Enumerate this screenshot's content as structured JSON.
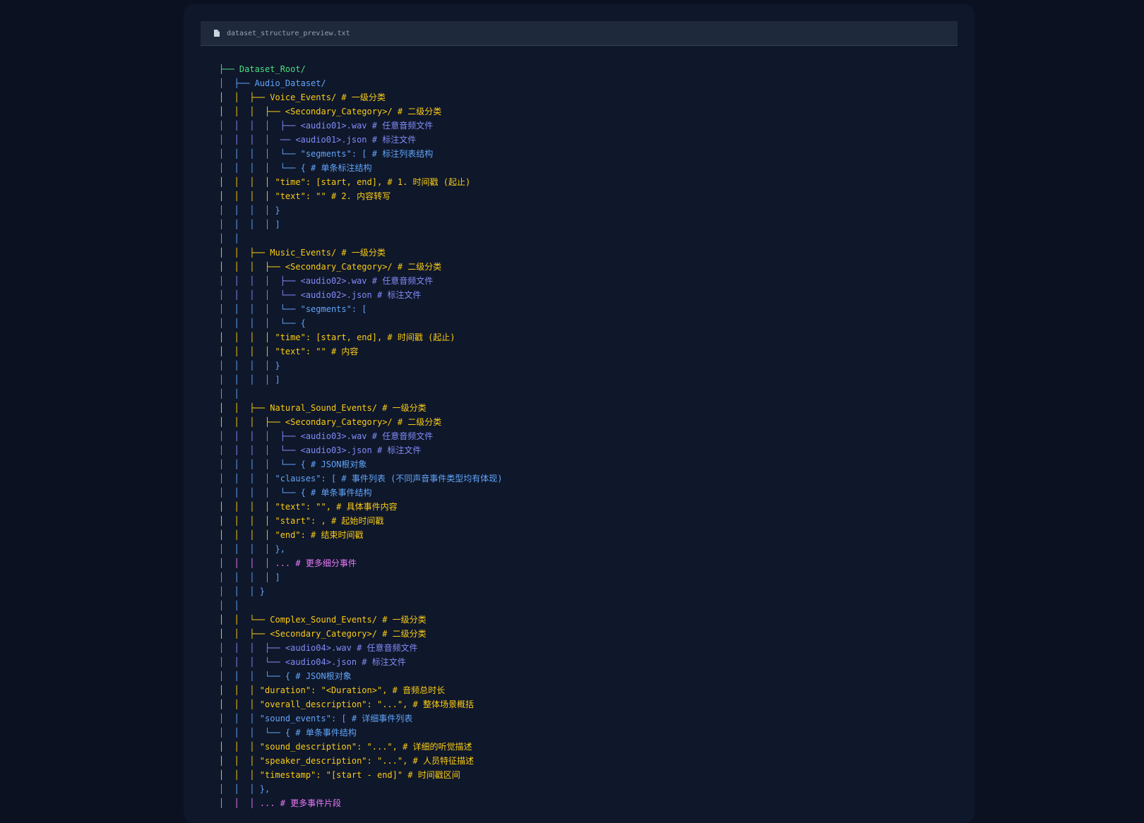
{
  "file": {
    "name": "dataset_structure_preview.txt",
    "icon": "file-icon"
  },
  "colors": {
    "background": "#0b1120",
    "panel": "#0f172a",
    "tab": "#1e293b",
    "green": "#4ade80",
    "blue": "#60a5fa",
    "yellow": "#facc15",
    "indigo": "#818cf8",
    "pink": "#e879f9"
  },
  "lines": [
    {
      "text": "├── Dataset_Root/",
      "color": "green"
    },
    {
      "text": "│  ├── Audio_Dataset/",
      "color": "blue"
    },
    {
      "text": "│  │  ├── Voice_Events/ # 一级分类",
      "color": "yellow"
    },
    {
      "text": "│  │  │  ├── <Secondary_Category>/ # 二级分类",
      "color": "yellow"
    },
    {
      "text": "│  │  │  │  ├── <audio01>.wav # 任意音频文件",
      "color": "indigo"
    },
    {
      "text": "│  │  │  │  ── <audio01>.json # 标注文件",
      "color": "indigo"
    },
    {
      "text": "│  │  │  │  └── \"segments\": [ # 标注列表结构",
      "color": "blue"
    },
    {
      "text": "│  │  │  │  └── { # 单条标注结构",
      "color": "blue"
    },
    {
      "text": "│  │  │  │ \"time\": [start, end], # 1. 时间戳 (起止)",
      "color": "yellow"
    },
    {
      "text": "│  │  │  │ \"text\": \"\" # 2. 内容转写",
      "color": "yellow"
    },
    {
      "text": "│  │  │  │ }",
      "color": "blue"
    },
    {
      "text": "│  │  │  │ ]",
      "color": "blue"
    },
    {
      "text": "│  │",
      "color": "blue"
    },
    {
      "text": "│  │  ├── Music_Events/ # 一级分类",
      "color": "yellow"
    },
    {
      "text": "│  │  │  ├── <Secondary_Category>/ # 二级分类",
      "color": "yellow"
    },
    {
      "text": "│  │  │  │  ├── <audio02>.wav # 任意音频文件",
      "color": "indigo"
    },
    {
      "text": "│  │  │  │  └── <audio02>.json # 标注文件",
      "color": "indigo"
    },
    {
      "text": "│  │  │  │  └── \"segments\": [",
      "color": "blue"
    },
    {
      "text": "│  │  │  │  └── {",
      "color": "blue"
    },
    {
      "text": "│  │  │  │ \"time\": [start, end], # 时间戳 (起止)",
      "color": "yellow"
    },
    {
      "text": "│  │  │  │ \"text\": \"\" # 内容",
      "color": "yellow"
    },
    {
      "text": "│  │  │  │ }",
      "color": "blue"
    },
    {
      "text": "│  │  │  │ ]",
      "color": "blue"
    },
    {
      "text": "│  │",
      "color": "blue"
    },
    {
      "text": "│  │  ├── Natural_Sound_Events/ # 一级分类",
      "color": "yellow"
    },
    {
      "text": "│  │  │  ├── <Secondary_Category>/ # 二级分类",
      "color": "yellow"
    },
    {
      "text": "│  │  │  │  ├── <audio03>.wav # 任意音频文件",
      "color": "indigo"
    },
    {
      "text": "│  │  │  │  └── <audio03>.json # 标注文件",
      "color": "indigo"
    },
    {
      "text": "│  │  │  │  └── { # JSON根对象",
      "color": "blue"
    },
    {
      "text": "│  │  │  │ \"clauses\": [ # 事件列表 (不同声音事件类型均有体现)",
      "color": "blue"
    },
    {
      "text": "│  │  │  │  └── { # 单条事件结构",
      "color": "blue"
    },
    {
      "text": "│  │  │  │ \"text\": \"\", # 具体事件内容",
      "color": "yellow"
    },
    {
      "text": "│  │  │  │ \"start\": , # 起始时间戳",
      "color": "yellow"
    },
    {
      "text": "│  │  │  │ \"end\": # 结束时间戳",
      "color": "yellow"
    },
    {
      "text": "│  │  │  │ },",
      "color": "blue"
    },
    {
      "text": "│  │  │  │ ... # 更多细分事件",
      "color": "pink"
    },
    {
      "text": "│  │  │  │ ]",
      "color": "blue"
    },
    {
      "text": "│  │  │ }",
      "color": "blue"
    },
    {
      "text": "│  │",
      "color": "blue"
    },
    {
      "text": "│  │  └── Complex_Sound_Events/ # 一级分类",
      "color": "yellow"
    },
    {
      "text": "│  │  ├── <Secondary_Category>/ # 二级分类",
      "color": "yellow"
    },
    {
      "text": "│  │  │  ├── <audio04>.wav # 任意音频文件",
      "color": "indigo"
    },
    {
      "text": "│  │  │  └── <audio04>.json # 标注文件",
      "color": "indigo"
    },
    {
      "text": "│  │  │  └── { # JSON根对象",
      "color": "blue"
    },
    {
      "text": "│  │  │ \"duration\": \"<Duration>\", # 音频总时长",
      "color": "yellow"
    },
    {
      "text": "│  │  │ \"overall_description\": \"...\", # 整体场景概括",
      "color": "yellow"
    },
    {
      "text": "│  │  │ \"sound_events\": [ # 详细事件列表",
      "color": "blue"
    },
    {
      "text": "│  │  │  └── { # 单条事件结构",
      "color": "blue"
    },
    {
      "text": "│  │  │ \"sound_description\": \"...\", # 详细的听觉描述",
      "color": "yellow"
    },
    {
      "text": "│  │  │ \"speaker_description\": \"...\", # 人员特征描述",
      "color": "yellow"
    },
    {
      "text": "│  │  │ \"timestamp\": \"[start - end]\" # 时间戳区间",
      "color": "yellow"
    },
    {
      "text": "│  │  │ },",
      "color": "blue"
    },
    {
      "text": "│  │  │ ... # 更多事件片段",
      "color": "pink"
    }
  ]
}
